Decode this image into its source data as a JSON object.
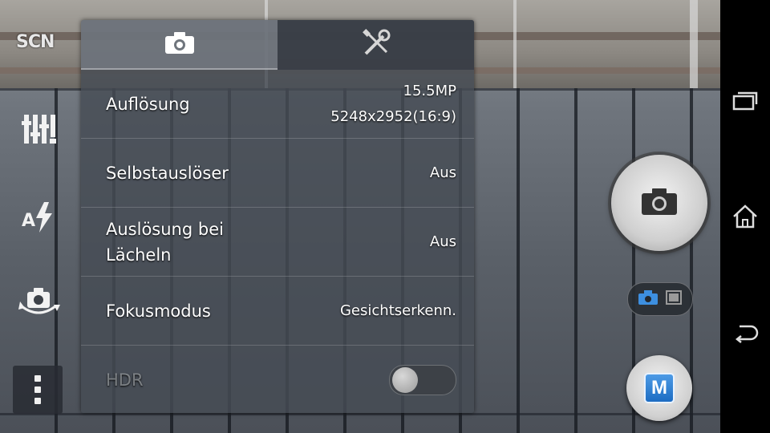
{
  "scene_badge": "SCN",
  "left_controls": [
    {
      "icon": "equalizer-sliders-icon"
    },
    {
      "icon": "auto-flash-icon"
    },
    {
      "icon": "switch-camera-icon"
    }
  ],
  "menu_button": {
    "icon": "vertical-dots-menu-icon"
  },
  "settings_panel": {
    "tabs": [
      {
        "icon": "camera-icon",
        "active": true
      },
      {
        "icon": "tools-icon",
        "active": false
      }
    ],
    "rows": [
      {
        "label": "Auflösung",
        "value_line1": "15.5MP",
        "value_line2": "5248x2952(16:9)"
      },
      {
        "label": "Selbstauslöser",
        "value": "Aus"
      },
      {
        "label": "Auslösung bei Lächeln",
        "value": "Aus"
      },
      {
        "label": "Fokusmodus",
        "value": "Gesichtserkenn."
      },
      {
        "label": "HDR",
        "toggle_on": false,
        "enabled": false
      }
    ]
  },
  "right_controls": {
    "shutter": {
      "icon": "camera-shutter-icon"
    },
    "mode_switch": {
      "selected": "photo",
      "icons": [
        "camera-mode-icon",
        "video-mode-icon"
      ]
    },
    "manual_mode": {
      "label": "M"
    }
  },
  "navbar": [
    {
      "icon": "recent-apps-icon"
    },
    {
      "icon": "home-icon"
    },
    {
      "icon": "back-icon"
    }
  ],
  "colors": {
    "accent": "#3d8fe0",
    "panel": "#464c54"
  }
}
